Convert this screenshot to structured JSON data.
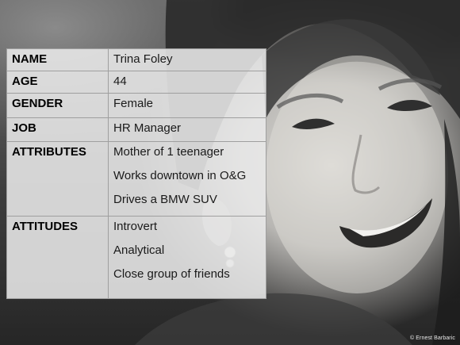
{
  "persona": {
    "rows": [
      {
        "label": "NAME",
        "values": [
          "Trina Foley"
        ]
      },
      {
        "label": "AGE",
        "values": [
          "44"
        ]
      },
      {
        "label": "GENDER",
        "values": [
          "Female"
        ]
      },
      {
        "label": "JOB",
        "values": [
          "HR Manager"
        ]
      },
      {
        "label": "ATTRIBUTES",
        "values": [
          "Mother of 1 teenager",
          "Works downtown in O&G",
          "Drives a BMW SUV"
        ]
      },
      {
        "label": "ATTITUDES",
        "values": [
          "Introvert",
          "Analytical",
          "Close group of friends"
        ]
      }
    ]
  },
  "credit": "© Ernest Barbaric"
}
